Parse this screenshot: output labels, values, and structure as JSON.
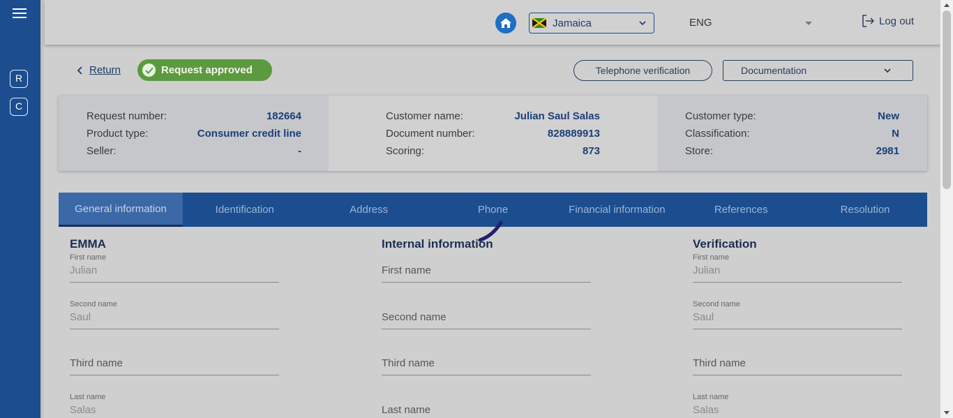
{
  "sidebar": {
    "menu_icon": "hamburger-menu-icon",
    "buttons": [
      {
        "label": "R"
      },
      {
        "label": "C"
      }
    ]
  },
  "header": {
    "home_icon": "home-icon",
    "country": {
      "value": "Jamaica",
      "flag_icon": "jamaica-flag-icon"
    },
    "language": {
      "value": "ENG"
    },
    "logout_label": "Log out"
  },
  "actions": {
    "return_label": "Return",
    "status_badge": "Request approved",
    "telephone_verification_label": "Telephone verification",
    "documentation_select": "Documentation"
  },
  "summary": {
    "left": [
      {
        "label": "Request number:",
        "value": "182664"
      },
      {
        "label": "Product type:",
        "value": "Consumer credit line"
      },
      {
        "label": "Seller:",
        "value": "-"
      }
    ],
    "middle": [
      {
        "label": "Customer name:",
        "value": "Julian Saul Salas"
      },
      {
        "label": "Document number:",
        "value": "828889913"
      },
      {
        "label": "Scoring:",
        "value": "873"
      }
    ],
    "right": [
      {
        "label": "Customer type:",
        "value": "New"
      },
      {
        "label": "Classification:",
        "value": "N"
      },
      {
        "label": "Store:",
        "value": "2981"
      }
    ]
  },
  "tabs": [
    {
      "label": "General information",
      "active": true
    },
    {
      "label": "Identification"
    },
    {
      "label": "Address"
    },
    {
      "label": "Phone"
    },
    {
      "label": "Financial information"
    },
    {
      "label": "References"
    },
    {
      "label": "Resolution"
    }
  ],
  "sections": {
    "emma": {
      "title": "EMMA",
      "fields": [
        {
          "label": "First name",
          "value": "Julian"
        },
        {
          "label": "Second name",
          "value": "Saul"
        },
        {
          "placeholder": "Third name"
        },
        {
          "label": "Last name",
          "value": "Salas"
        }
      ]
    },
    "internal": {
      "title": "Internal information",
      "fields": [
        {
          "placeholder": "First name"
        },
        {
          "placeholder": "Second name"
        },
        {
          "placeholder": "Third name"
        },
        {
          "placeholder": "Last name"
        }
      ]
    },
    "verification": {
      "title": "Verification",
      "fields": [
        {
          "label": "First name",
          "value": "Julian"
        },
        {
          "label": "Second name",
          "value": "Saul"
        },
        {
          "placeholder": "Third name"
        },
        {
          "label": "Last name",
          "value": "Salas"
        }
      ]
    }
  },
  "colors": {
    "primary": "#1c4d8f",
    "success": "#5c9a3f",
    "accent_home": "#1f6fc2"
  }
}
